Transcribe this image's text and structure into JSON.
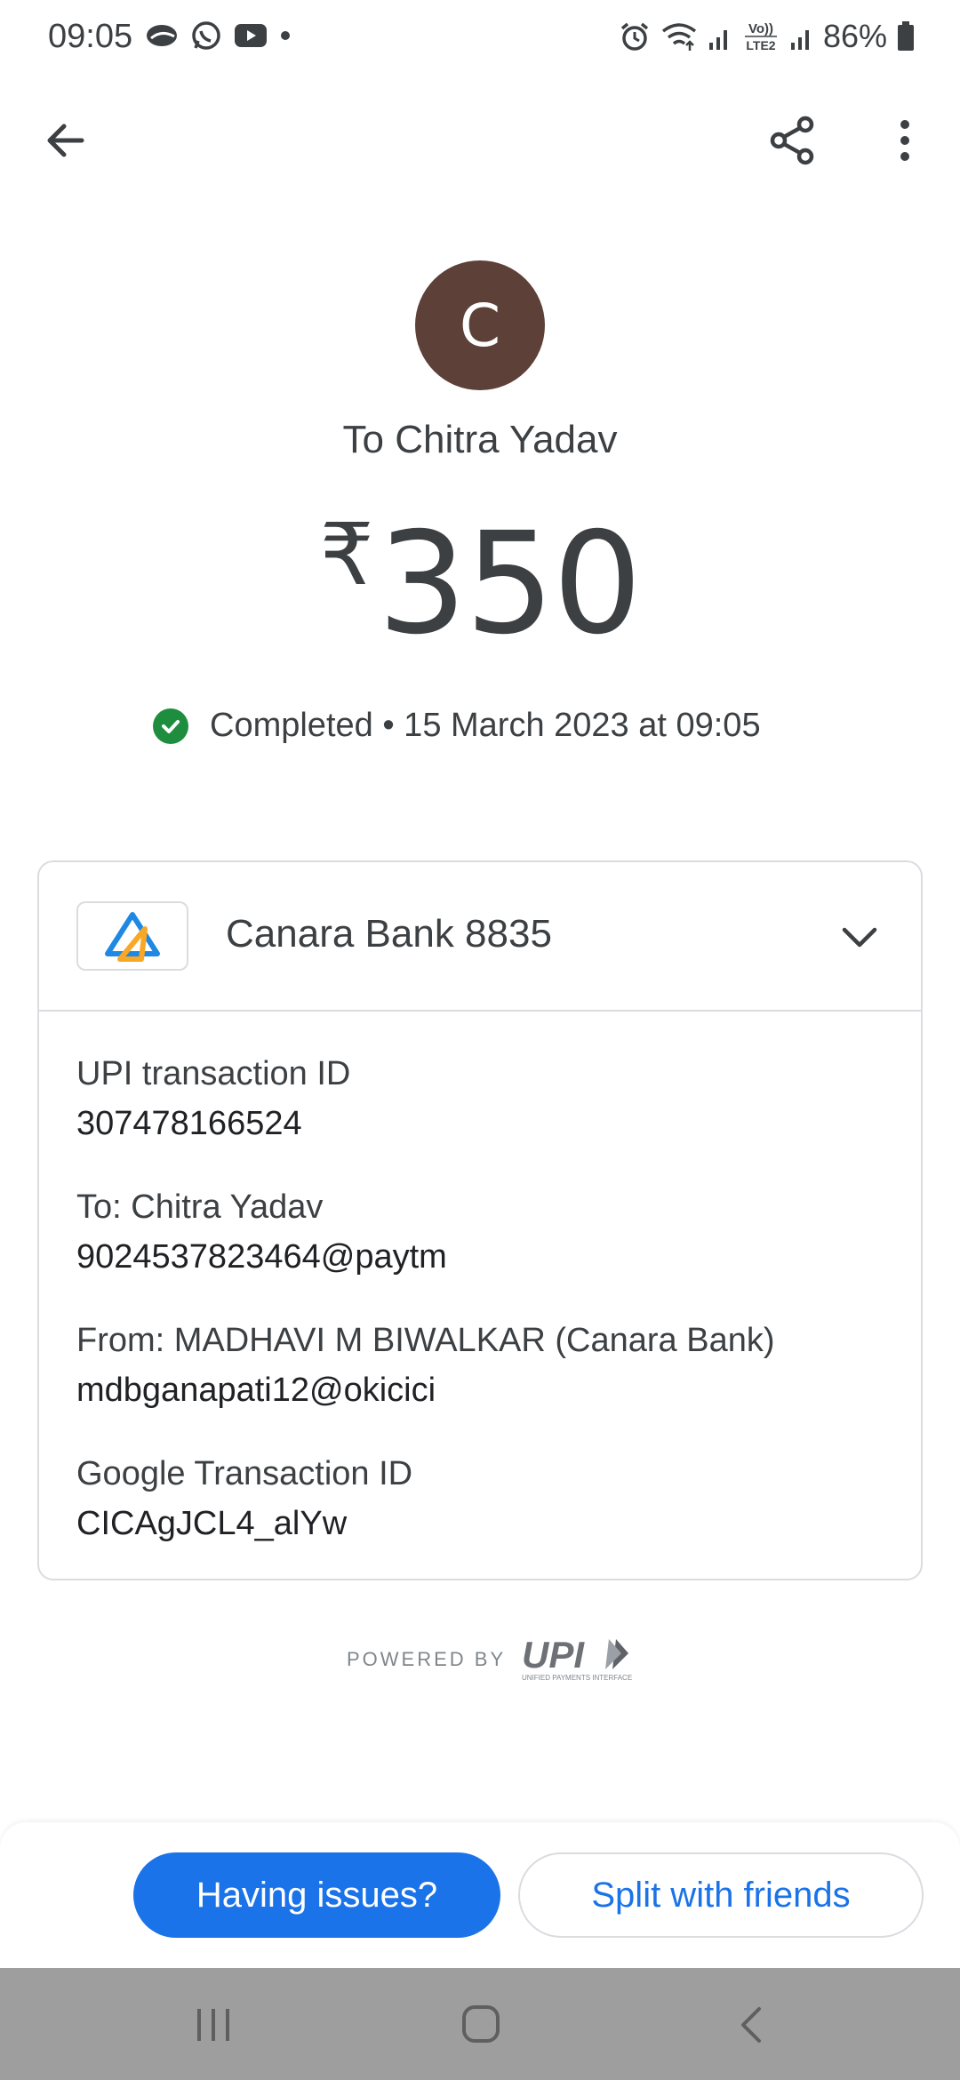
{
  "status_bar": {
    "time": "09:05",
    "left_icons": [
      "app-icon",
      "whatsapp-icon",
      "youtube-icon",
      "dot-icon"
    ],
    "right_icons": [
      "alarm-icon",
      "wifi-icon",
      "signal-icon",
      "volte-icon",
      "signal-icon"
    ],
    "volte_label": "Vo)) LTE2",
    "battery": "86%"
  },
  "app_bar": {
    "icons": [
      "back-arrow-icon",
      "share-icon",
      "more-vert-icon"
    ]
  },
  "recipient": {
    "avatar_initial": "C",
    "avatar_color": "#5d4037",
    "to_line": "To Chitra Yadav"
  },
  "payment": {
    "currency": "₹",
    "amount": "350",
    "status": "Completed • 15 March 2023 at 09:05",
    "status_color": "#1e8e3e"
  },
  "card": {
    "bank": "Canara Bank 8835",
    "details": [
      {
        "label": "UPI transaction ID",
        "value": "307478166524"
      },
      {
        "label": "To: Chitra Yadav",
        "value": "9024537823464@paytm"
      },
      {
        "label": "From: MADHAVI M BIWALKAR (Canara Bank)",
        "value": "mdbganapati12@okicici"
      },
      {
        "label": "Google Transaction ID",
        "value": "CICAgJCL4_alYw"
      }
    ]
  },
  "footer": {
    "powered_by": "POWERED BY",
    "upi_logo": "UPI",
    "upi_tagline": "UNIFIED PAYMENTS INTERFACE"
  },
  "actions": {
    "issues": "Having issues?",
    "split": "Split with friends",
    "accent": "#1a73e8"
  },
  "nav": {
    "icons": [
      "recents-icon",
      "home-icon",
      "back-icon"
    ]
  }
}
